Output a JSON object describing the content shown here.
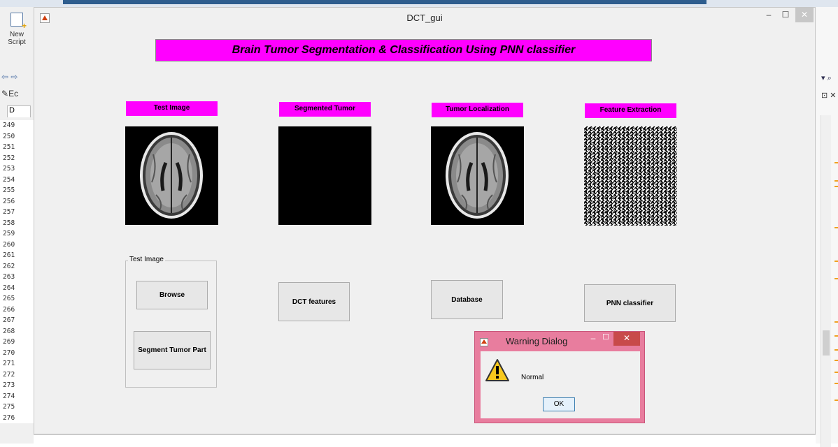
{
  "editor": {
    "new_script_line1": "New",
    "new_script_line2": "Script",
    "nav_arrows": "⇦ ⇨",
    "editor_label": "Ec",
    "tab_label": "D",
    "line_numbers": [
      "249",
      "250",
      "251",
      "252",
      "253",
      "254",
      "255",
      "256",
      "257",
      "258",
      "259",
      "260",
      "261",
      "262",
      "263",
      "264",
      "265",
      "266",
      "267",
      "268",
      "269",
      "270",
      "271",
      "272",
      "273",
      "274",
      "275",
      "276"
    ],
    "right_symbol_1": "▾ ⌕",
    "right_symbol_2": "⊡ ✕"
  },
  "figure": {
    "title": "DCT_gui",
    "min_icon": "–",
    "max_icon": "☐",
    "close_icon": "✕",
    "main_title": "Brain Tumor Segmentation & Classification Using PNN classifier",
    "label_color": "#ff00ff",
    "panels": [
      {
        "label": "Test Image"
      },
      {
        "label": "Segmented Tumor"
      },
      {
        "label": "Tumor Localization"
      },
      {
        "label": "Feature Extraction"
      }
    ],
    "test_group_label": "Test Image",
    "buttons": {
      "browse": "Browse",
      "segment": "Segment Tumor Part",
      "dct": "DCT features",
      "database": "Database",
      "pnn": "PNN classifier"
    }
  },
  "dialog": {
    "title": "Warning Dialog",
    "min_icon": "–",
    "max_icon": "☐",
    "close_icon": "✕",
    "message": "Normal",
    "ok_label": "OK",
    "accent": "#e87d9e"
  }
}
